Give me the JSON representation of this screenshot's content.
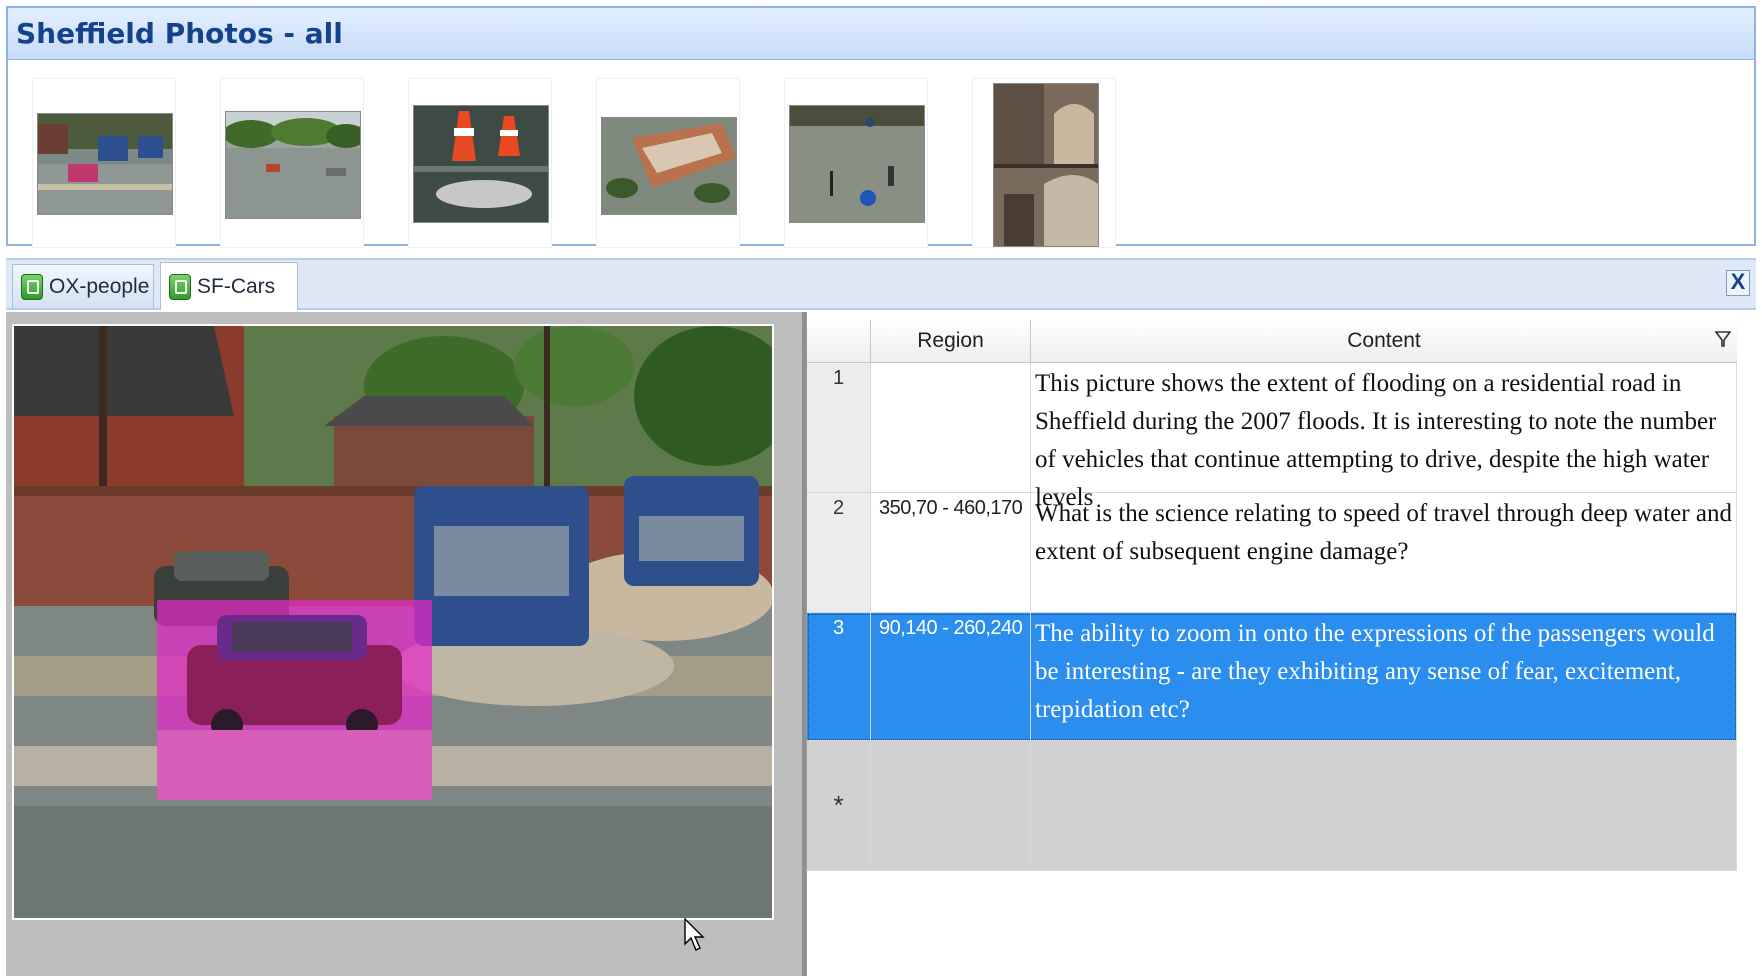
{
  "gallery": {
    "title": "Sheffield Photos - all",
    "thumbnails": [
      {
        "name": "flood-road-vehicles"
      },
      {
        "name": "flooded-park"
      },
      {
        "name": "traffic-cones-fish"
      },
      {
        "name": "aerial-flooded-houses"
      },
      {
        "name": "flooded-road-sign"
      },
      {
        "name": "archway-street"
      }
    ]
  },
  "tabs": [
    {
      "label": "OX-people",
      "active": false
    },
    {
      "label": "SF-Cars",
      "active": true
    }
  ],
  "close_label": "X",
  "grid": {
    "headers": {
      "region": "Region",
      "content": "Content"
    },
    "rows": [
      {
        "num": "1",
        "region": "",
        "content": "This picture shows the extent of flooding on a residential road in Sheffield during the 2007 floods. It is interesting to note the number of vehicles that continue attempting to drive, despite the high water levels"
      },
      {
        "num": "2",
        "region": "350,70 - 460,170",
        "content": "What is the science relating to speed of travel through deep water and extent of subsequent engine damage?"
      },
      {
        "num": "3",
        "region": "90,140 - 260,240",
        "content": "The ability to zoom in onto the expressions of the passengers would be interesting - are they exhibiting any sense of fear, excitement, trepidation etc?"
      }
    ],
    "new_row_marker": "*"
  },
  "colors": {
    "selection": "#2b8ded",
    "header_text": "#15428b",
    "region_overlay": "#e628c8"
  }
}
